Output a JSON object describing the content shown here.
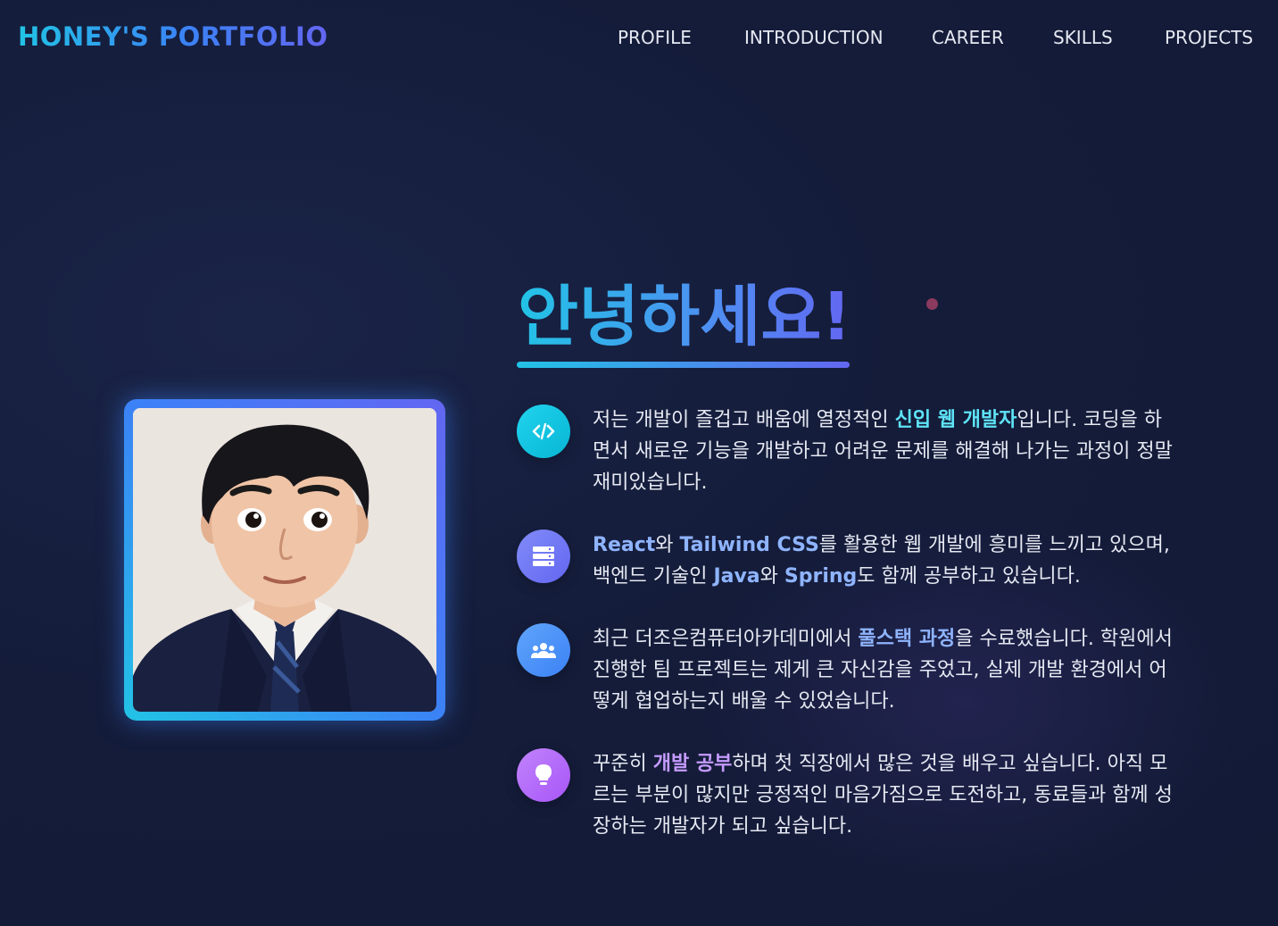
{
  "nav": {
    "brand": "HONEY'S PORTFOLIO",
    "items": [
      {
        "label": "PROFILE"
      },
      {
        "label": "INTRODUCTION"
      },
      {
        "label": "CAREER"
      },
      {
        "label": "SKILLS"
      },
      {
        "label": "PROJECTS"
      }
    ]
  },
  "hero": {
    "title": "안녕하세요!"
  },
  "profile_photo": {
    "alt": "Profile photo"
  },
  "intro": [
    {
      "icon": "code-icon",
      "color": "#22c3e6",
      "parts": [
        {
          "t": "저는 개발이 즐겁고 배움에 열정적인 "
        },
        {
          "t": "신입 웹 개발자",
          "hl": "cyan"
        },
        {
          "t": "입니다. 코딩을 하면서 새로운 기능을 개발하고 어려운 문제를 해결해 나가는 과정이 정말 재미있습니다."
        }
      ]
    },
    {
      "icon": "server-icon",
      "color": "#6366f1",
      "parts": [
        {
          "t": "React",
          "hl": "blue"
        },
        {
          "t": "와 "
        },
        {
          "t": "Tailwind CSS",
          "hl": "blue"
        },
        {
          "t": "를 활용한 웹 개발에 흥미를 느끼고 있으며, 백엔드 기술인 "
        },
        {
          "t": "Java",
          "hl": "blue"
        },
        {
          "t": "와 "
        },
        {
          "t": "Spring",
          "hl": "blue"
        },
        {
          "t": "도 함께 공부하고 있습니다."
        }
      ]
    },
    {
      "icon": "users-icon",
      "color": "#3b82f6",
      "parts": [
        {
          "t": "최근 더조은컴퓨터아카데미에서 "
        },
        {
          "t": "풀스택 과정",
          "hl": "blue"
        },
        {
          "t": "을 수료했습니다. 학원에서 진행한 팀 프로젝트는 제게 큰 자신감을 주었고, 실제 개발 환경에서 어떻게 협업하는지 배울 수 있었습니다."
        }
      ]
    },
    {
      "icon": "lightbulb-icon",
      "color": "#a855f7",
      "parts": [
        {
          "t": "꾸준히 "
        },
        {
          "t": "개발 공부",
          "hl": "purple"
        },
        {
          "t": "하며 첫 직장에서 많은 것을 배우고 싶습니다. 아직 모르는 부분이 많지만 긍정적인 마음가짐으로 도전하고, 동료들과 함께 성장하는 개발자가 되고 싶습니다."
        }
      ]
    }
  ]
}
